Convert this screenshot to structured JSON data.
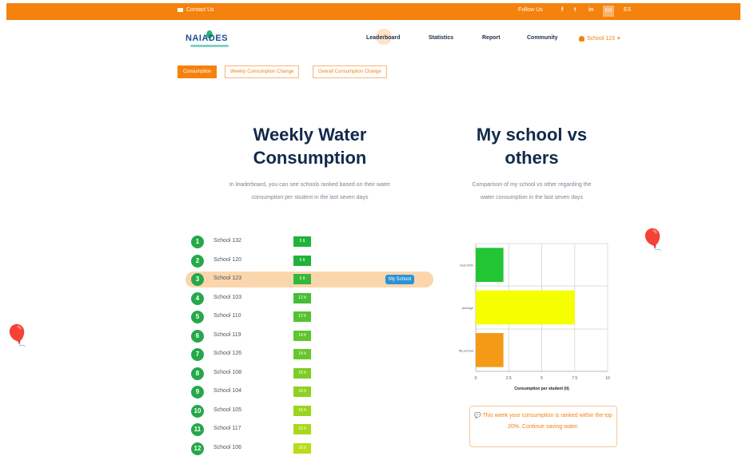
{
  "topbar": {
    "contact_label": "Contact Us",
    "follow_label": "Follow Us",
    "social": [
      "f",
      "t",
      "in"
    ],
    "languages": [
      "EN",
      "ES"
    ]
  },
  "brand": {
    "logo_text": "NAIADES"
  },
  "nav": {
    "items": [
      "Leaderboard",
      "Statistics",
      "Report",
      "Community"
    ],
    "active": "Leaderboard",
    "user_label": "School 123"
  },
  "subtabs": {
    "items": [
      "Consumption",
      "Weekly Consumption Change",
      "Overall Consumption Change"
    ],
    "active": "Consumption"
  },
  "leaderboard": {
    "title_line1": "Weekly Water",
    "title_line2": "Consumption",
    "desc_line1": "In leaderboard, you can see schools ranked based on their water",
    "desc_line2": "consumption per student in the last seven days",
    "my_school_label": "My School",
    "rows": [
      {
        "rank": "1",
        "name": "School 132",
        "value": "5 lt",
        "color": "#21b238"
      },
      {
        "rank": "2",
        "name": "School 120",
        "value": "5 lt",
        "color": "#21b238"
      },
      {
        "rank": "3",
        "name": "School 123",
        "value": "5 lt",
        "color": "#34b83a",
        "me": true
      },
      {
        "rank": "4",
        "name": "School 103",
        "value": "12 lt",
        "color": "#45bd34"
      },
      {
        "rank": "5",
        "name": "School 110",
        "value": "12 lt",
        "color": "#56c22f"
      },
      {
        "rank": "6",
        "name": "School 119",
        "value": "14 lt",
        "color": "#5fc52d"
      },
      {
        "rank": "7",
        "name": "School 126",
        "value": "14 lt",
        "color": "#67c72b"
      },
      {
        "rank": "8",
        "name": "School 108",
        "value": "15 lt",
        "color": "#7fcc26"
      },
      {
        "rank": "9",
        "name": "School 104",
        "value": "16 lt",
        "color": "#8ed023"
      },
      {
        "rank": "10",
        "name": "School 105",
        "value": "16 lt",
        "color": "#9ad41f"
      },
      {
        "rank": "11",
        "name": "School 117",
        "value": "16 lt",
        "color": "#a9d81b"
      },
      {
        "rank": "12",
        "name": "School 106",
        "value": "18 lt",
        "color": "#b7dc18"
      }
    ]
  },
  "comparison": {
    "title_line1": "My school vs",
    "title_line2": "others",
    "desc_line1": "Comparison of my school vs other regarding the",
    "desc_line2": "water consumption in the last seven days",
    "message": "This week your consumption is ranked within the top 20%. Continue saving water."
  },
  "chart_data": {
    "type": "bar",
    "orientation": "horizontal",
    "categories": [
      "best 20%",
      "average",
      "My school"
    ],
    "values": [
      2.1,
      7.5,
      2.1
    ],
    "colors": [
      "#22c634",
      "#f6ff00",
      "#f59a17"
    ],
    "xlabel": "Consumption per student (lt)",
    "xlim": [
      0,
      10
    ],
    "xticks": [
      "0",
      "2.5",
      "5",
      "7.5",
      "10"
    ],
    "grid": true
  }
}
